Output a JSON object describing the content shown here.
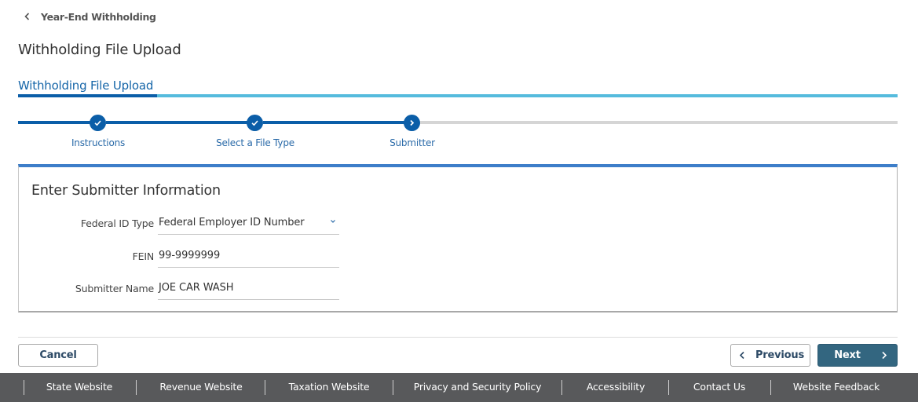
{
  "breadcrumb": {
    "label": "Year-End Withholding",
    "icon": "chevron-left-icon"
  },
  "page": {
    "title": "Withholding File Upload"
  },
  "tab": {
    "label": "Withholding File Upload"
  },
  "colors": {
    "primary": "#0b5ea8",
    "tab_underline": "#55bbdd",
    "panel_accent": "#3d7ec9",
    "next_button": "#336680",
    "footer_bg": "#58595b",
    "step_incomplete": "#d5d5d5"
  },
  "stepper": {
    "steps": [
      {
        "label": "Instructions",
        "status": "complete",
        "icon": "check-icon"
      },
      {
        "label": "Select a File Type",
        "status": "complete",
        "icon": "check-icon"
      },
      {
        "label": "Submitter",
        "status": "current",
        "icon": "chevron-right-icon"
      }
    ]
  },
  "panel": {
    "title": "Enter Submitter Information",
    "fields": [
      {
        "label": "Federal ID Type",
        "value": "Federal Employer ID Number",
        "type": "select"
      },
      {
        "label": "FEIN",
        "value": "99-9999999",
        "type": "text"
      },
      {
        "label": "Submitter Name",
        "value": "JOE CAR WASH",
        "type": "text"
      }
    ]
  },
  "actions": {
    "cancel": "Cancel",
    "previous": "Previous",
    "next": "Next"
  },
  "footer": {
    "links": [
      "State Website",
      "Revenue Website",
      "Taxation Website",
      "Privacy and Security Policy",
      "Accessibility",
      "Contact Us",
      "Website Feedback"
    ]
  }
}
